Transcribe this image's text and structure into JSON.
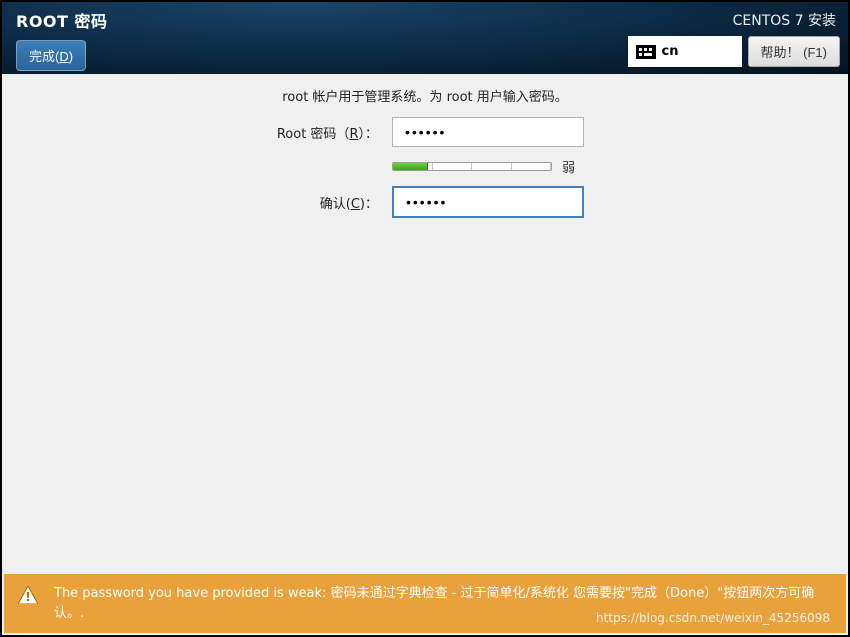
{
  "header": {
    "title": "ROOT 密码",
    "done_label_pre": "完成(",
    "done_key": "D",
    "done_label_post": ")",
    "installer_label": "CENTOS 7 安装",
    "keyboard_layout": "cn",
    "help_label": "帮助！ (F1)"
  },
  "main": {
    "description": "root 帐户用于管理系统。为 root 用户输入密码。",
    "password_label_pre": "Root 密码（",
    "password_key": "R",
    "password_label_post": "）：",
    "password_value": "••••••",
    "confirm_label_pre": "确认(",
    "confirm_key": "C",
    "confirm_label_post": ")：",
    "confirm_value": "••••••",
    "strength": {
      "percent": 22,
      "label": "弱"
    }
  },
  "warning": {
    "message": "The password you have provided is weak: 密码未通过字典检查 - 过于简单化/系统化 您需要按\"完成（Done）\"按钮两次方可确认。."
  },
  "watermark": "https://blog.csdn.net/weixin_45256098"
}
